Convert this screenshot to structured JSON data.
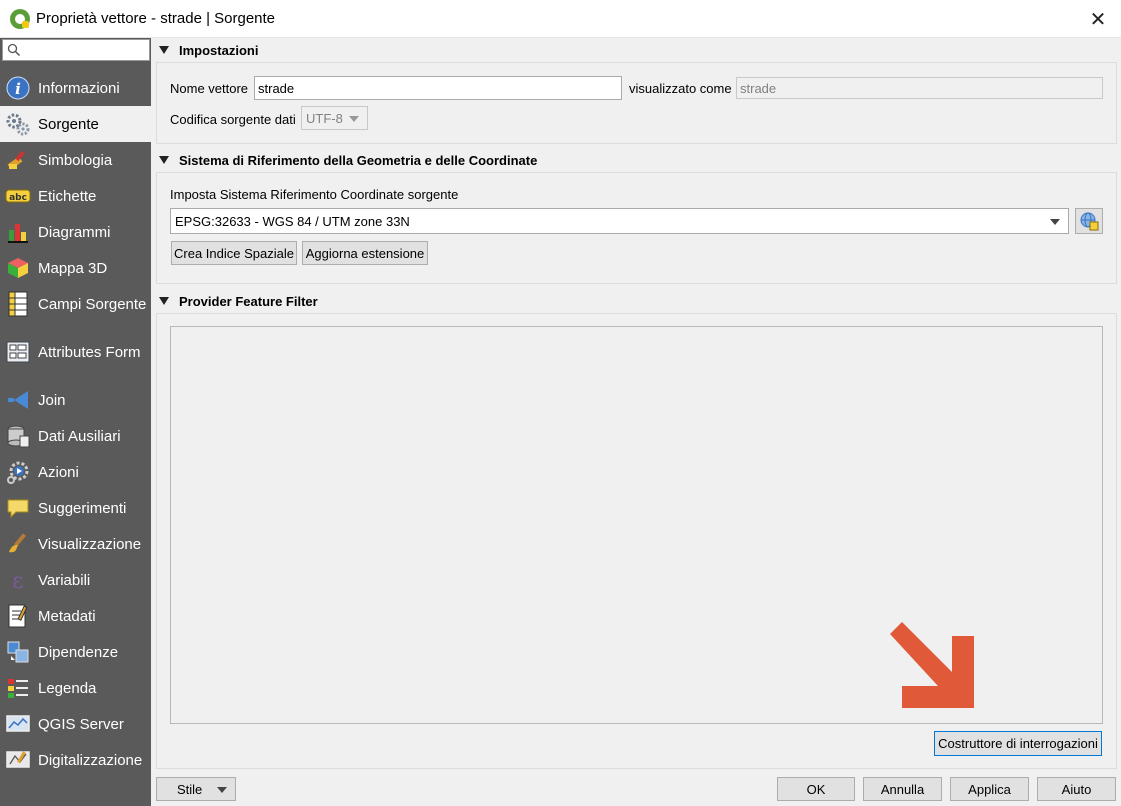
{
  "window": {
    "title": "Proprietà vettore - strade | Sorgente",
    "close_glyph": "✕"
  },
  "sidebar": {
    "search_placeholder": "",
    "items": [
      {
        "label": "Informazioni",
        "icon": "info-icon"
      },
      {
        "label": "Sorgente",
        "icon": "source-gears-icon"
      },
      {
        "label": "Simbologia",
        "icon": "symbology-brush-icon"
      },
      {
        "label": "Etichette",
        "icon": "labels-abc-icon"
      },
      {
        "label": "Diagrammi",
        "icon": "diagram-icon"
      },
      {
        "label": "Mappa 3D",
        "icon": "3d-cube-icon"
      },
      {
        "label": "Campi Sorgente",
        "icon": "fields-icon"
      },
      {
        "label": "Attributes Form",
        "icon": "form-icon"
      },
      {
        "label": "Join",
        "icon": "join-icon"
      },
      {
        "label": "Dati Ausiliari",
        "icon": "auxiliary-storage-icon"
      },
      {
        "label": "Azioni",
        "icon": "actions-gear-icon"
      },
      {
        "label": "Suggerimenti",
        "icon": "tooltip-bubble-icon"
      },
      {
        "label": "Visualizzazione",
        "icon": "rendering-brush-icon"
      },
      {
        "label": "Variabili",
        "icon": "variables-epsilon-icon"
      },
      {
        "label": "Metadati",
        "icon": "metadata-pen-icon"
      },
      {
        "label": "Dipendenze",
        "icon": "dependencies-icon"
      },
      {
        "label": "Legenda",
        "icon": "legend-icon"
      },
      {
        "label": "QGIS Server",
        "icon": "qgis-server-icon"
      },
      {
        "label": "Digitalizzazione",
        "icon": "digitizing-icon"
      }
    ],
    "selected": "Sorgente"
  },
  "settings": {
    "header": "Impostazioni",
    "layer_name_label": "Nome vettore",
    "layer_name_value": "strade",
    "displayed_as_label": "visualizzato come",
    "displayed_as_value": "strade",
    "encoding_label": "Codifica sorgente dati",
    "encoding_value": "UTF-8"
  },
  "crs": {
    "header": "Sistema di Riferimento della Geometria e delle Coordinate",
    "set_source_label": "Imposta Sistema Riferimento Coordinate sorgente",
    "selected_crs": "EPSG:32633 - WGS 84 / UTM zone 33N",
    "create_index_button": "Crea Indice Spaziale",
    "update_extent_button": "Aggiorna estensione"
  },
  "filter": {
    "header": "Provider Feature Filter",
    "value": "",
    "query_builder_button": "Costruttore di interrogazioni"
  },
  "annotation": {
    "color": "#e05a3a"
  },
  "bottom": {
    "style_button": "Stile",
    "ok_button": "OK",
    "cancel_button": "Annulla",
    "apply_button": "Applica",
    "help_button": "Aiuto"
  }
}
